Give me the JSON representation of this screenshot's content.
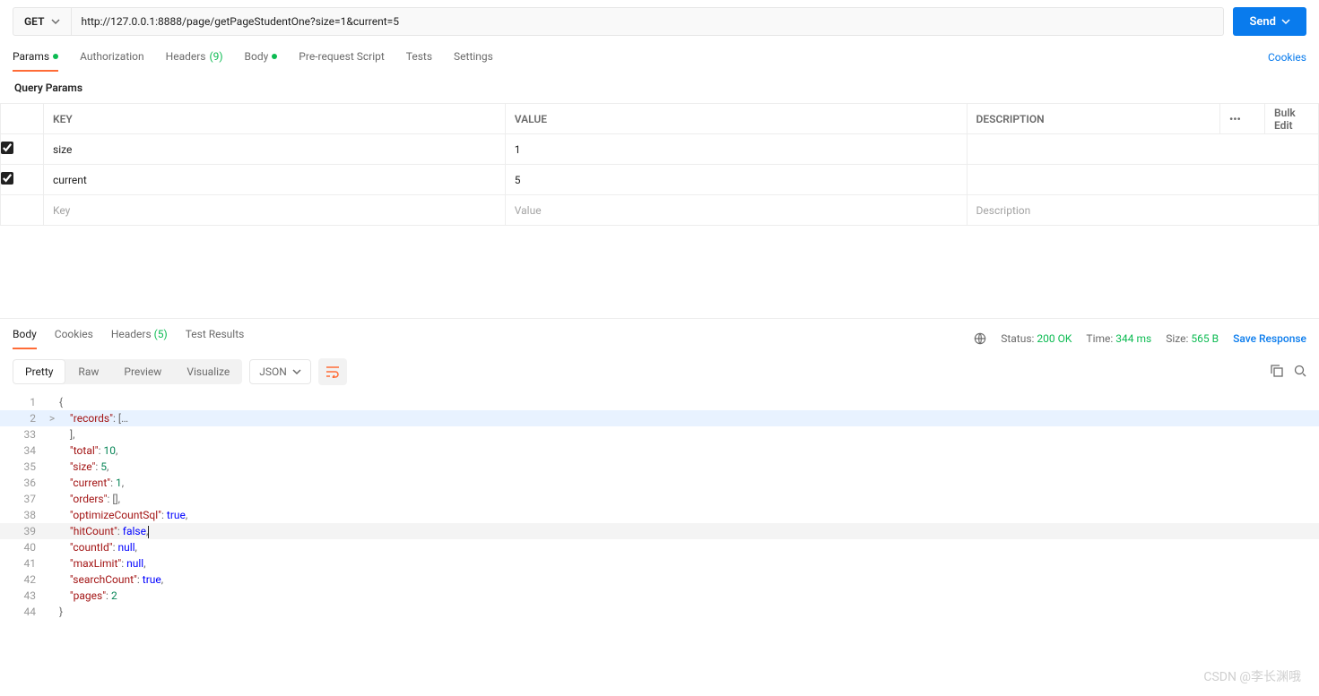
{
  "request": {
    "method": "GET",
    "url": "http://127.0.0.1:8888/page/getPageStudentOne?size=1&current=5",
    "send_label": "Send"
  },
  "req_tabs": {
    "params": "Params",
    "authorization": "Authorization",
    "headers": "Headers",
    "headers_count": "(9)",
    "body": "Body",
    "prerequest": "Pre-request Script",
    "tests": "Tests",
    "settings": "Settings",
    "cookies": "Cookies"
  },
  "params_section": {
    "title": "Query Params",
    "headers": {
      "key": "KEY",
      "value": "VALUE",
      "description": "DESCRIPTION",
      "bulk": "Bulk Edit"
    },
    "rows": [
      {
        "checked": true,
        "key": "size",
        "value": "1",
        "description": ""
      },
      {
        "checked": true,
        "key": "current",
        "value": "5",
        "description": ""
      }
    ],
    "placeholders": {
      "key": "Key",
      "value": "Value",
      "description": "Description"
    }
  },
  "resp_tabs": {
    "body": "Body",
    "cookies": "Cookies",
    "headers": "Headers",
    "headers_count": "(5)",
    "testresults": "Test Results"
  },
  "resp_meta": {
    "status_label": "Status:",
    "status_value": "200 OK",
    "time_label": "Time:",
    "time_value": "344 ms",
    "size_label": "Size:",
    "size_value": "565 B",
    "save": "Save Response"
  },
  "view": {
    "pretty": "Pretty",
    "raw": "Raw",
    "preview": "Preview",
    "visualize": "Visualize",
    "format": "JSON"
  },
  "code_lines": [
    {
      "n": 1,
      "fold": "",
      "c": [
        [
          "p",
          "{"
        ]
      ]
    },
    {
      "n": 2,
      "fold": ">",
      "hl": true,
      "c": [
        [
          "i",
          "    "
        ],
        [
          "k",
          "\"records\""
        ],
        [
          "p",
          ": ["
        ],
        [
          "d",
          "…"
        ]
      ]
    },
    {
      "n": 33,
      "fold": "",
      "c": [
        [
          "i",
          "    "
        ],
        [
          "p",
          "],"
        ]
      ]
    },
    {
      "n": 34,
      "fold": "",
      "c": [
        [
          "i",
          "    "
        ],
        [
          "k",
          "\"total\""
        ],
        [
          "p",
          ": "
        ],
        [
          "n",
          "10"
        ],
        [
          "p",
          ","
        ]
      ]
    },
    {
      "n": 35,
      "fold": "",
      "c": [
        [
          "i",
          "    "
        ],
        [
          "k",
          "\"size\""
        ],
        [
          "p",
          ": "
        ],
        [
          "n",
          "5"
        ],
        [
          "p",
          ","
        ]
      ]
    },
    {
      "n": 36,
      "fold": "",
      "c": [
        [
          "i",
          "    "
        ],
        [
          "k",
          "\"current\""
        ],
        [
          "p",
          ": "
        ],
        [
          "n",
          "1"
        ],
        [
          "p",
          ","
        ]
      ]
    },
    {
      "n": 37,
      "fold": "",
      "c": [
        [
          "i",
          "    "
        ],
        [
          "k",
          "\"orders\""
        ],
        [
          "p",
          ": [],"
        ]
      ]
    },
    {
      "n": 38,
      "fold": "",
      "c": [
        [
          "i",
          "    "
        ],
        [
          "k",
          "\"optimizeCountSql\""
        ],
        [
          "p",
          ": "
        ],
        [
          "b",
          "true"
        ],
        [
          "p",
          ","
        ]
      ]
    },
    {
      "n": 39,
      "fold": "",
      "cur": true,
      "c": [
        [
          "i",
          "    "
        ],
        [
          "k",
          "\"hitCount\""
        ],
        [
          "p",
          ": "
        ],
        [
          "b",
          "false"
        ],
        [
          "p",
          ","
        ],
        [
          "cur",
          ""
        ]
      ]
    },
    {
      "n": 40,
      "fold": "",
      "c": [
        [
          "i",
          "    "
        ],
        [
          "k",
          "\"countId\""
        ],
        [
          "p",
          ": "
        ],
        [
          "u",
          "null"
        ],
        [
          "p",
          ","
        ]
      ]
    },
    {
      "n": 41,
      "fold": "",
      "c": [
        [
          "i",
          "    "
        ],
        [
          "k",
          "\"maxLimit\""
        ],
        [
          "p",
          ": "
        ],
        [
          "u",
          "null"
        ],
        [
          "p",
          ","
        ]
      ]
    },
    {
      "n": 42,
      "fold": "",
      "c": [
        [
          "i",
          "    "
        ],
        [
          "k",
          "\"searchCount\""
        ],
        [
          "p",
          ": "
        ],
        [
          "b",
          "true"
        ],
        [
          "p",
          ","
        ]
      ]
    },
    {
      "n": 43,
      "fold": "",
      "c": [
        [
          "i",
          "    "
        ],
        [
          "k",
          "\"pages\""
        ],
        [
          "p",
          ": "
        ],
        [
          "n",
          "2"
        ]
      ]
    },
    {
      "n": 44,
      "fold": "",
      "c": [
        [
          "p",
          "}"
        ]
      ]
    }
  ],
  "watermark": "CSDN @李长渊哦"
}
